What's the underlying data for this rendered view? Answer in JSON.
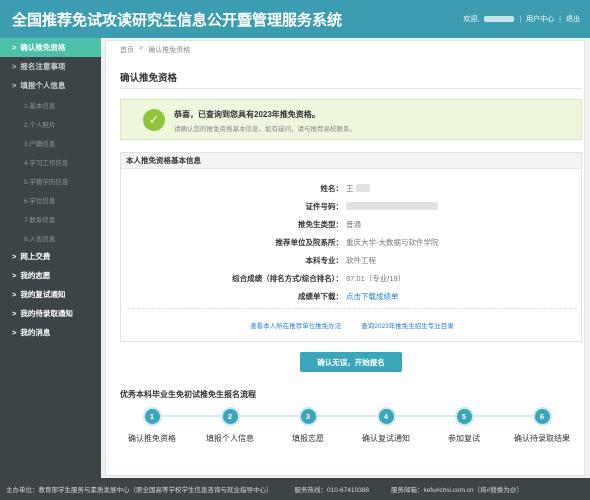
{
  "header": {
    "title": "全国推荐免试攻读研究生信息公开暨管理服务系统",
    "welcome": "欢迎,",
    "user_center": "用户中心",
    "logout": "退出"
  },
  "sidebar": {
    "items": [
      {
        "label": "确认推免资格",
        "active": true,
        "sub": false
      },
      {
        "label": "报名注意事项",
        "active": false,
        "sub": false
      },
      {
        "label": "填报个人信息",
        "active": false,
        "sub": false
      },
      {
        "label": "1.基本信息",
        "sub": true
      },
      {
        "label": "2.个人照片",
        "sub": true
      },
      {
        "label": "3.户籍信息",
        "sub": true
      },
      {
        "label": "4.学习工作信息",
        "sub": true
      },
      {
        "label": "5.学籍学历信息",
        "sub": true
      },
      {
        "label": "6.学位信息",
        "sub": true
      },
      {
        "label": "7.联系信息",
        "sub": true
      },
      {
        "label": "8.入伍信息",
        "sub": true
      },
      {
        "label": "网上交费",
        "active": false,
        "sub": false
      },
      {
        "label": "我的志愿",
        "active": false,
        "sub": false
      },
      {
        "label": "我的复试通知",
        "active": false,
        "sub": false
      },
      {
        "label": "我的待录取通知",
        "active": false,
        "sub": false
      },
      {
        "label": "我的消息",
        "active": false,
        "sub": false
      }
    ]
  },
  "breadcrumb": {
    "home": "首页",
    "separator": ">",
    "current": "确认推免资格"
  },
  "page_title": "确认推免资格",
  "success": {
    "title": "恭喜，已查询到您具有2023年推免资格。",
    "subtitle": "请确认您的推免资格基本信息，如有疑问，请与推荐高校联系。"
  },
  "info": {
    "heading": "本人推免资格基本信息",
    "rows": [
      {
        "label": "姓名：",
        "value": "王"
      },
      {
        "label": "证件号码：",
        "value": ""
      },
      {
        "label": "推免生类型：",
        "value": "普通"
      },
      {
        "label": "推荐单位及院系所：",
        "value": "重庆大学-大数据与软件学院"
      },
      {
        "label": "本科专业：",
        "value": "软件工程"
      },
      {
        "label": "综合成绩（排名方式/综合排名）：",
        "value": "87.01（专业/19）"
      },
      {
        "label": "成绩单下载：",
        "value": "点击下载成绩单"
      }
    ],
    "link1": "查看本人所在推荐单位推免办法",
    "link2": "查询2023年推免生招生专业目录"
  },
  "confirm_button": "确认无误，开始报名",
  "flow": {
    "title": "优秀本科毕业生免初试推免生报名流程",
    "steps": [
      {
        "num": "1",
        "label": "确认推免资格"
      },
      {
        "num": "2",
        "label": "填报个人信息"
      },
      {
        "num": "3",
        "label": "填报志愿"
      },
      {
        "num": "4",
        "label": "确认复试通知"
      },
      {
        "num": "5",
        "label": "参加复试"
      },
      {
        "num": "6",
        "label": "确认待录取结果"
      }
    ]
  },
  "footer": {
    "org": "主办单位：教育部学生服务与素质发展中心（原全国高等学校学生信息咨询与就业指导中心）",
    "hotline": "服务热线：010-67410388",
    "email": "服务邮箱：kefu#chsi.com.cn（将#替换为@）"
  },
  "colors": {
    "header": "#3d9db0",
    "sidebar": "#3b4548",
    "sidebar_active": "#4cc1a8",
    "success_bg": "#eef7dd",
    "check": "#8fc43b",
    "button": "#3aa6ba",
    "link": "#2a7bd6"
  }
}
